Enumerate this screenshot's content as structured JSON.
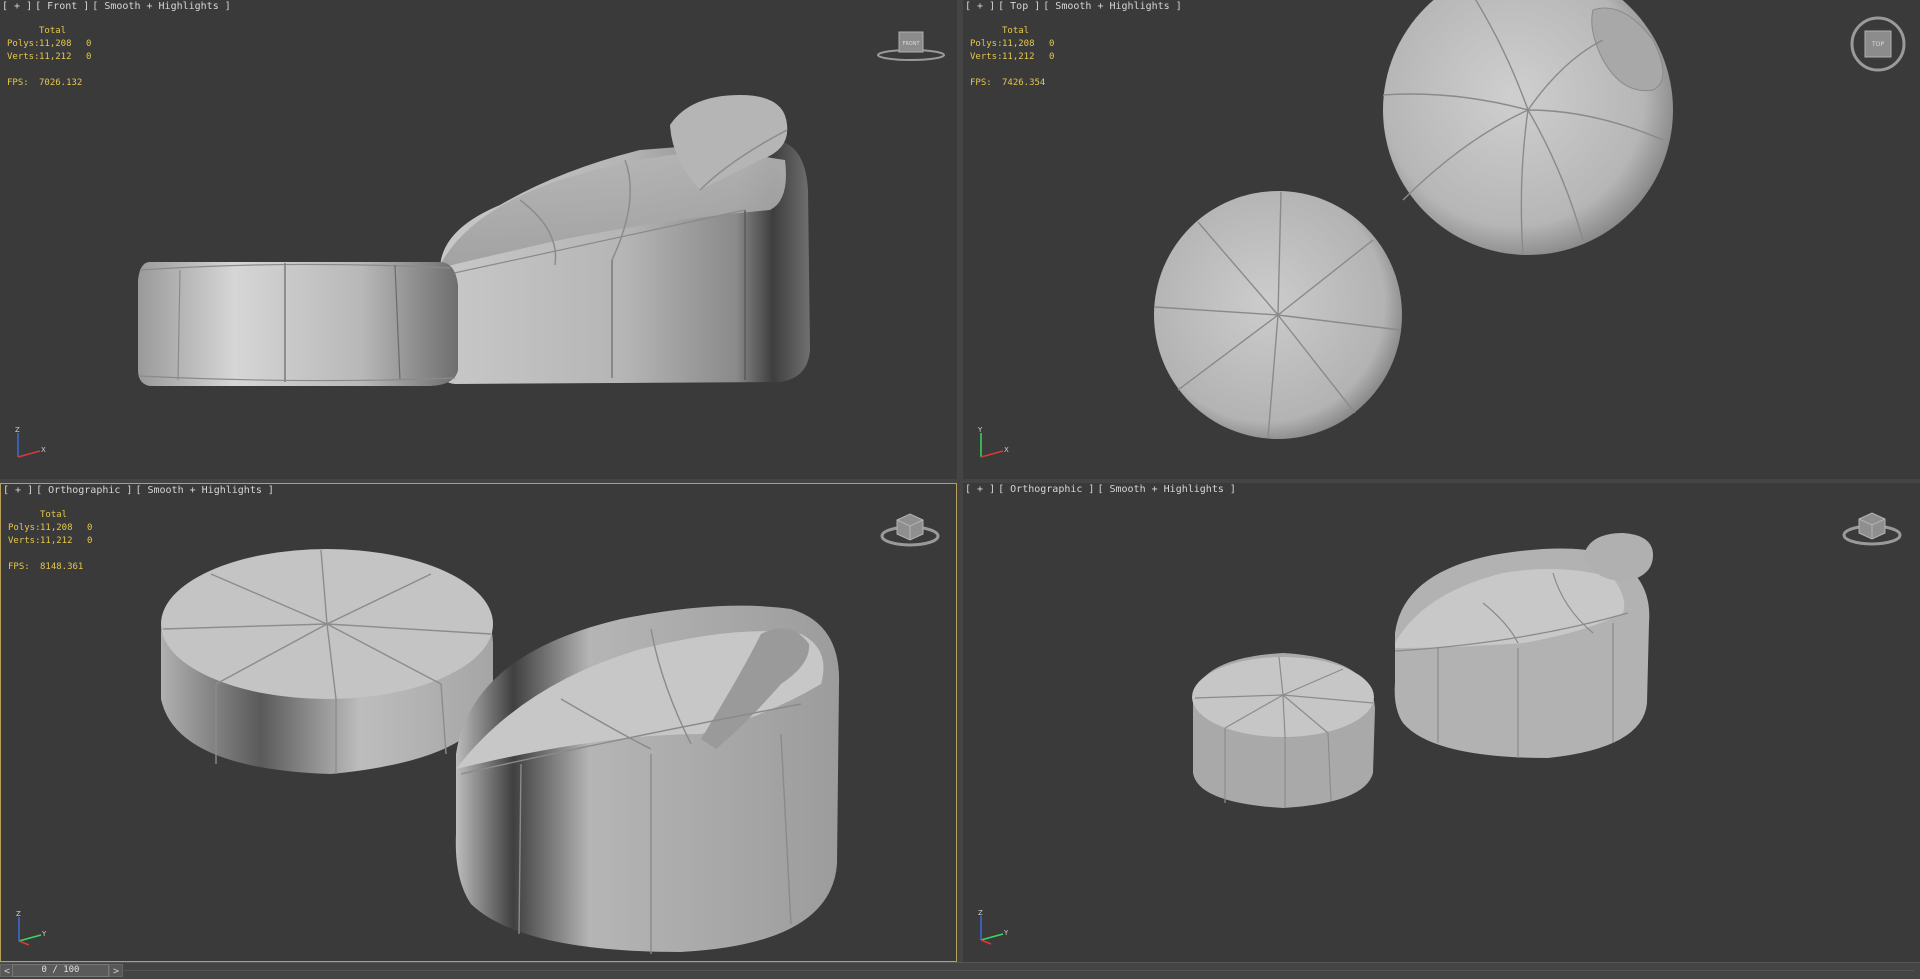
{
  "viewports": [
    {
      "id": "front",
      "label": {
        "plus": "[ + ]",
        "view": "[ Front ]",
        "shading": "[ Smooth + Highlights ]"
      },
      "stats": {
        "header": "Total",
        "polys_label": "Polys:",
        "polys": "11,208",
        "polys_sel": "0",
        "verts_label": "Verts:",
        "verts": "11,212",
        "verts_sel": "0",
        "fps_label": "FPS:",
        "fps": "7026.132"
      },
      "viewcube_face": "FRONT",
      "axis": {
        "a": "Z",
        "b": "X"
      }
    },
    {
      "id": "top",
      "label": {
        "plus": "[ + ]",
        "view": "[ Top ]",
        "shading": "[ Smooth + Highlights ]"
      },
      "stats": {
        "header": "Total",
        "polys_label": "Polys:",
        "polys": "11,208",
        "polys_sel": "0",
        "verts_label": "Verts:",
        "verts": "11,212",
        "verts_sel": "0",
        "fps_label": "FPS:",
        "fps": "7426.354"
      },
      "viewcube_face": "TOP",
      "axis": {
        "a": "Y",
        "b": "X"
      }
    },
    {
      "id": "ortho1",
      "label": {
        "plus": "[ + ]",
        "view": "[ Orthographic ]",
        "shading": "[ Smooth + Highlights ]"
      },
      "stats": {
        "header": "Total",
        "polys_label": "Polys:",
        "polys": "11,208",
        "polys_sel": "0",
        "verts_label": "Verts:",
        "verts": "11,212",
        "verts_sel": "0",
        "fps_label": "FPS:",
        "fps": "8148.361"
      },
      "viewcube_face": "",
      "axis": {
        "a": "Z",
        "b": "Y"
      }
    },
    {
      "id": "ortho2",
      "label": {
        "plus": "[ + ]",
        "view": "[ Orthographic ]",
        "shading": "[ Smooth + Highlights ]"
      },
      "stats": null,
      "viewcube_face": "",
      "axis": {
        "a": "Z",
        "b": "Y"
      }
    }
  ],
  "timeline": {
    "prev": "<",
    "slider": "0 / 100",
    "next": ">"
  },
  "colors": {
    "viewport_bg": "#3a3a3a",
    "active_border": "#b9a05a",
    "stats_text": "#e6c84a",
    "label_text": "#d6d6d6"
  }
}
